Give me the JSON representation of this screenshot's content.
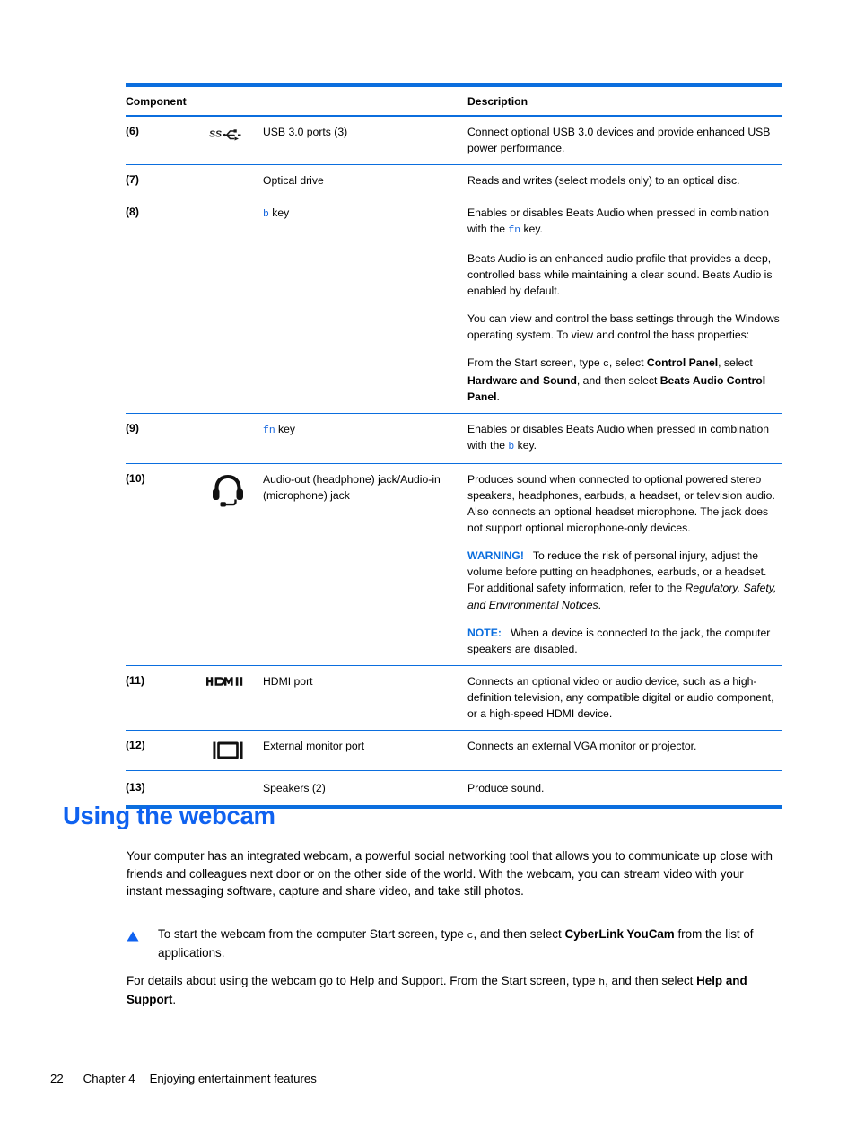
{
  "table": {
    "headers": {
      "component": "Component",
      "description": "Description"
    },
    "rows": [
      {
        "num": "(6)",
        "icon": "usb-superspeed-icon",
        "name": "USB 3.0 ports (3)",
        "desc_paragraphs": [
          "Connect optional USB 3.0 devices and provide enhanced USB power performance."
        ]
      },
      {
        "num": "(7)",
        "icon": "none",
        "name": "Optical drive",
        "desc_paragraphs": [
          "Reads and writes (select models only) to an optical disc."
        ]
      },
      {
        "num": "(8)",
        "icon": "none",
        "name_key": "b",
        "name_suffix": " key",
        "desc_paragraphs": [
          "Enables or disables Beats Audio when pressed in combination with the fn key.",
          "Beats Audio is an enhanced audio profile that provides a deep, controlled bass while maintaining a clear sound. Beats Audio is enabled by default.",
          "You can view and control the bass settings through the Windows operating system. To view and control the bass properties:",
          "From the Start screen, type c, select Control Panel, select Hardware and Sound, and then select Beats Audio Control Panel."
        ]
      },
      {
        "num": "(9)",
        "icon": "none",
        "name_key": "fn",
        "name_suffix": " key",
        "desc_paragraphs": [
          "Enables or disables Beats Audio when pressed in combination with the b key."
        ]
      },
      {
        "num": "(10)",
        "icon": "headset-icon",
        "name": "Audio-out (headphone) jack/Audio-in (microphone) jack",
        "desc_paragraphs": [
          "Produces sound when connected to optional powered stereo speakers, headphones, earbuds, a headset, or television audio. Also connects an optional headset microphone. The jack does not support optional microphone-only devices.",
          "WARNING! To reduce the risk of personal injury, adjust the volume before putting on headphones, earbuds, or a headset. For additional safety information, refer to the Regulatory, Safety, and Environmental Notices.",
          "NOTE: When a device is connected to the jack, the computer speakers are disabled."
        ],
        "warning_label": "WARNING!",
        "note_label": "NOTE:"
      },
      {
        "num": "(11)",
        "icon": "hdmi-icon",
        "name": "HDMI port",
        "desc_paragraphs": [
          "Connects an optional video or audio device, such as a high-definition television, any compatible digital or audio component, or a high-speed HDMI device."
        ]
      },
      {
        "num": "(12)",
        "icon": "external-monitor-icon",
        "name": "External monitor port",
        "desc_paragraphs": [
          "Connects an external VGA monitor or projector."
        ]
      },
      {
        "num": "(13)",
        "icon": "none",
        "name": "Speakers (2)",
        "desc_paragraphs": [
          "Produce sound."
        ]
      }
    ]
  },
  "section": {
    "heading": "Using the webcam",
    "intro": "Your computer has an integrated webcam, a powerful social networking tool that allows you to communicate up close with friends and colleagues next door or on the other side of the world. With the webcam, you can stream video with your instant messaging software, capture and share video, and take still photos.",
    "bullet": {
      "marker": "triangle-bullet-icon",
      "text_before_key": "To start the webcam from the computer Start screen, type ",
      "key": "c",
      "text_after_key": ", and then select ",
      "bold_app": "CyberLink YouCam",
      "text_end": " from the list of applications."
    },
    "outro": {
      "text_before_key": "For details about using the webcam go to Help and Support. From the Start screen, type ",
      "key": "h",
      "text_after_key": ", and then select ",
      "bold_target": "Help and Support",
      "text_end": "."
    }
  },
  "footer": {
    "page_number": "22",
    "chapter": "Chapter 4",
    "chapter_title": "Enjoying entertainment features"
  },
  "colors": {
    "rule_blue": "#0b6ede",
    "heading_blue": "#0f62f0",
    "key_blue": "#1666dd",
    "label_blue": "#0b6ede"
  }
}
